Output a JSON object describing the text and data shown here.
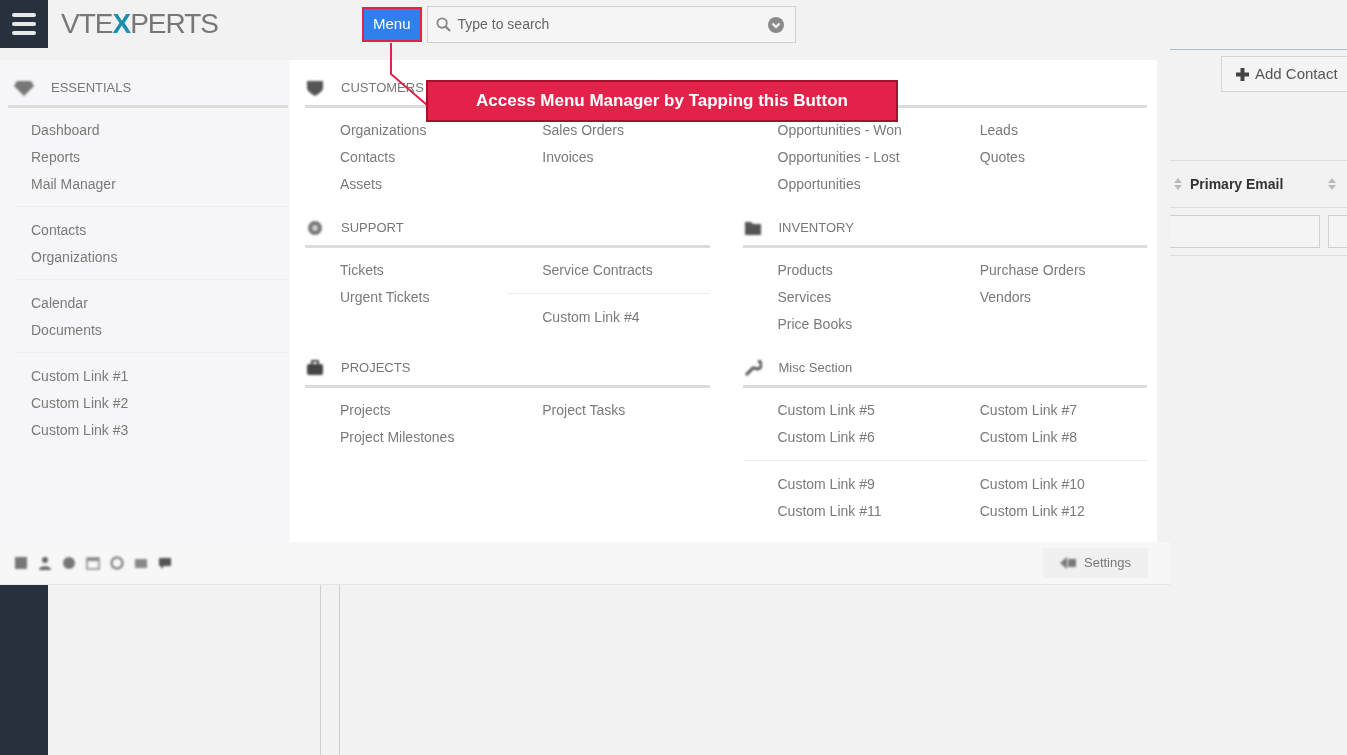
{
  "header": {
    "logo": [
      {
        "text": "VTE",
        "accent": false
      },
      {
        "text": "X",
        "accent": true
      },
      {
        "text": "PERTS",
        "accent": false
      }
    ],
    "menu_button": "Menu",
    "search": {
      "placeholder": "Type to search"
    }
  },
  "callout": "Access Menu Manager by Tapping this Button",
  "menu": {
    "sidebar": {
      "title": "ESSENTIALS",
      "groups": [
        [
          "Dashboard",
          "Reports",
          "Mail Manager"
        ],
        [
          "Contacts",
          "Organizations"
        ],
        [
          "Calendar",
          "Documents"
        ],
        [
          "Custom Link #1",
          "Custom Link #2",
          "Custom Link #3"
        ]
      ]
    },
    "sections": [
      {
        "title": "CUSTOMERS",
        "columns": [
          [
            [
              "Organizations",
              "Contacts",
              "Assets"
            ]
          ],
          [
            [
              "Sales Orders",
              "Invoices"
            ]
          ]
        ]
      },
      {
        "columns": [
          [
            [
              "Opportunities - Won",
              "Opportunities - Lost",
              "Opportunities"
            ]
          ],
          [
            [
              "Leads",
              "Quotes"
            ]
          ]
        ]
      },
      {
        "title": "SUPPORT",
        "columns": [
          [
            [
              "Tickets",
              "Urgent Tickets"
            ]
          ],
          [
            [
              "Service Contracts"
            ],
            [
              "Custom Link #4"
            ]
          ]
        ]
      },
      {
        "title": "INVENTORY",
        "columns": [
          [
            [
              "Products",
              "Services",
              "Price Books"
            ]
          ],
          [
            [
              "Purchase Orders",
              "Vendors"
            ]
          ]
        ]
      },
      {
        "title": "PROJECTS",
        "columns": [
          [
            [
              "Projects",
              "Project Milestones"
            ]
          ],
          [
            [
              "Project Tasks"
            ]
          ]
        ]
      },
      {
        "title": "Misc Section",
        "columns": [
          [
            [
              "Custom Link #5",
              "Custom Link #6"
            ],
            [
              "Custom Link #9",
              "Custom Link #11"
            ]
          ],
          [
            [
              "Custom Link #7",
              "Custom Link #8"
            ],
            [
              "Custom Link #10",
              "Custom Link #12"
            ]
          ]
        ]
      }
    ],
    "settings": "Settings"
  },
  "content": {
    "add_button": "Add Contact",
    "column_header": "Primary Email"
  }
}
